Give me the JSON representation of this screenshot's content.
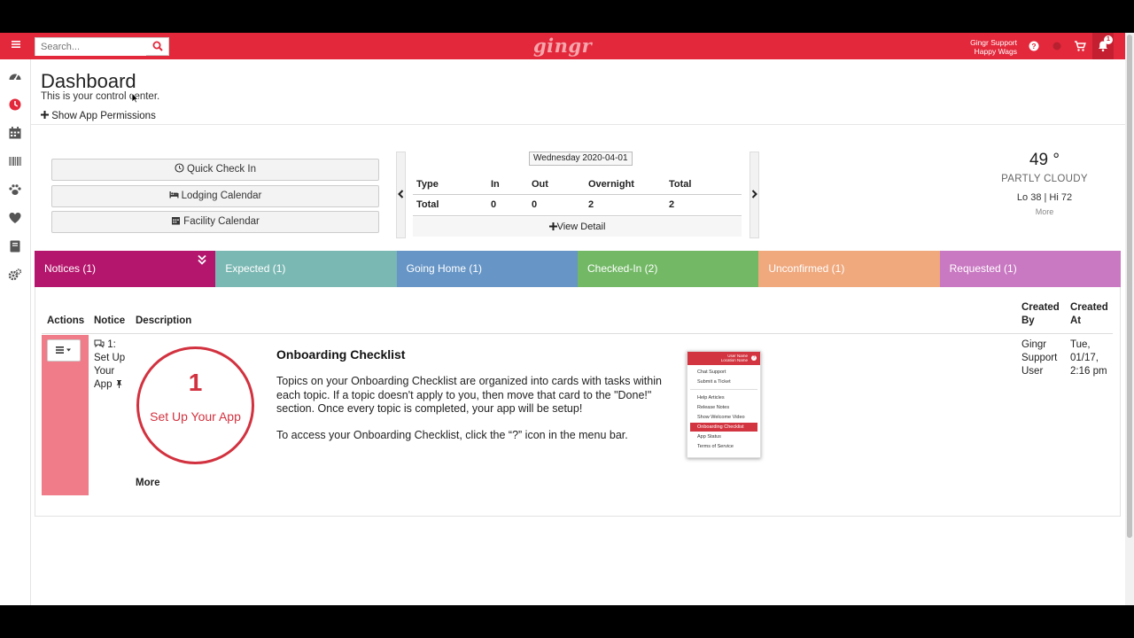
{
  "search": {
    "placeholder": "Search..."
  },
  "brand": {
    "logo": "gingr",
    "bar_color": "#e3283b"
  },
  "user": {
    "name": "Gingr Support",
    "location": "Happy Wags"
  },
  "notifications": {
    "count": "1"
  },
  "sidebar": {
    "items": [
      {
        "icon": "dashboard-gauge-icon"
      },
      {
        "icon": "clock-icon"
      },
      {
        "icon": "calendar-icon"
      },
      {
        "icon": "barcode-icon"
      },
      {
        "icon": "paw-icon"
      },
      {
        "icon": "heart-icon"
      },
      {
        "icon": "book-icon"
      },
      {
        "icon": "cogs-icon"
      }
    ]
  },
  "header": {
    "title": "Dashboard",
    "subtitle": "This is your control center.",
    "permissions_link": "Show App Permissions"
  },
  "quick_actions": {
    "check_in": "Quick Check In",
    "lodging": "Lodging Calendar",
    "facility": "Facility Calendar"
  },
  "occupancy": {
    "date": "Wednesday 2020-04-01",
    "headers": [
      "Type",
      "In",
      "Out",
      "Overnight",
      "Total"
    ],
    "rows": [
      [
        "Total",
        "0",
        "0",
        "2",
        "2"
      ]
    ],
    "view_detail": "View Detail"
  },
  "weather": {
    "temp": "49 °",
    "condition": "PARTLY CLOUDY",
    "range": "Lo 38 | Hi 72",
    "more": "More"
  },
  "tabs": [
    {
      "label": "Notices (1)",
      "color": "#b5166d"
    },
    {
      "label": "Expected (1)",
      "color": "#7ab8b3"
    },
    {
      "label": "Going Home (1)",
      "color": "#6695c6"
    },
    {
      "label": "Checked-In (2)",
      "color": "#72b865"
    },
    {
      "label": "Unconfirmed (1)",
      "color": "#f0a87d"
    },
    {
      "label": "Requested (1)",
      "color": "#c978c2"
    }
  ],
  "notices": {
    "headers": {
      "actions": "Actions",
      "notice": "Notice",
      "description": "Description",
      "created_by": "Created By",
      "created_at": "Created At"
    },
    "row": {
      "notice": "1: Set Up Your App",
      "circle_number": "1",
      "circle_label": "Set Up Your App",
      "title": "Onboarding Checklist",
      "body": "Topics on your Onboarding Checklist are organized into cards with tasks within each topic. If a topic doesn't apply to you, then move that card to the \"Done!\" section. Once every topic is completed, your app will be setup!",
      "body2": "To access your Onboarding Checklist, click the “?” icon in the menu bar.",
      "more": "More",
      "created_by": "Gingr Support User",
      "created_at": "Tue, 01/17, 2:16 pm",
      "row_color": "#ef7c88"
    },
    "menu_image": {
      "user_name": "User Name",
      "location_name": "Location Name",
      "items": [
        "Chat Support",
        "Submit a Ticket",
        "Help Articles",
        "Release Notes",
        "Show Welcome Video",
        "Onboarding Checklist",
        "App Status",
        "Terms of Service"
      ]
    }
  }
}
